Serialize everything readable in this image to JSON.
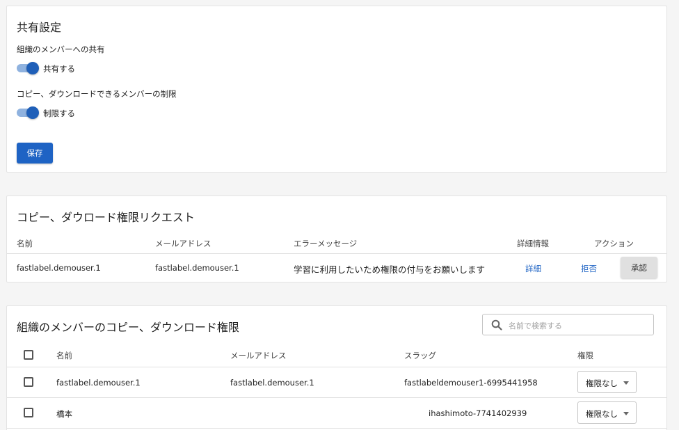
{
  "sharing": {
    "title": "共有設定",
    "org_share_label": "組織のメンバーへの共有",
    "org_share_toggle_label": "共有する",
    "org_share_enabled": true,
    "restrict_label": "コピー、ダウンロードできるメンバーの制限",
    "restrict_toggle_label": "制限する",
    "restrict_enabled": true,
    "save_label": "保存"
  },
  "requests": {
    "title": "コピー、ダウロード権限リクエスト",
    "columns": [
      "名前",
      "メールアドレス",
      "エラーメッセージ",
      "詳細情報",
      "アクション"
    ],
    "rows": [
      {
        "name": "fastlabel.demouser.1",
        "email": "fastlabel.demouser.1",
        "message": "学習に利用したいため権限の付与をお願いします",
        "detail_label": "詳細",
        "reject_label": "拒否",
        "approve_label": "承認"
      }
    ]
  },
  "members": {
    "title": "組織のメンバーのコピー、ダウンロード権限",
    "search_placeholder": "名前で検索する",
    "columns": [
      "名前",
      "メールアドレス",
      "スラッグ",
      "権限"
    ],
    "rows": [
      {
        "name": "fastlabel.demouser.1",
        "email": "fastlabel.demouser.1",
        "slug": "fastlabeldemouser1-6995441958",
        "permission": "権限なし"
      },
      {
        "name": "橋本",
        "email": "",
        "slug": "ihashimoto-7741402939",
        "permission": "権限なし"
      }
    ]
  },
  "colors": {
    "primary": "#1e63c4",
    "toggle_track": "#8fb2df",
    "background": "#f5f5f5"
  }
}
